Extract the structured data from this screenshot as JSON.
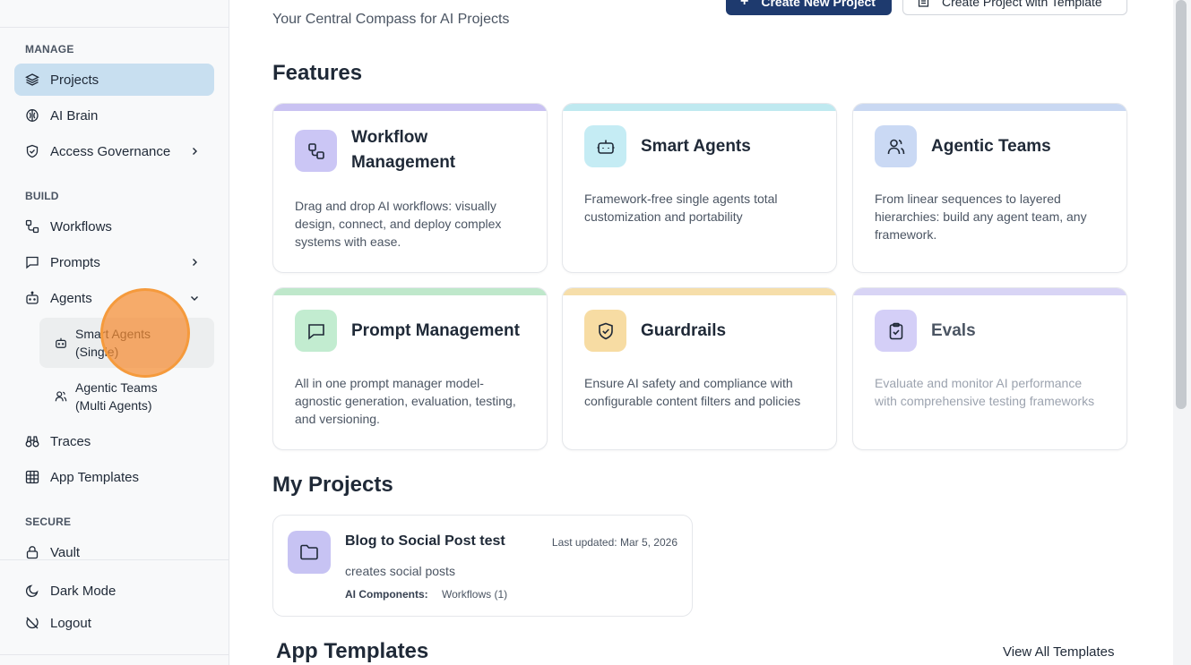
{
  "sidebar": {
    "sections": {
      "manage": "MANAGE",
      "build": "BUILD",
      "secure": "SECURE"
    },
    "items": {
      "projects": "Projects",
      "ai_brain": "AI Brain",
      "access_governance": "Access Governance",
      "workflows": "Workflows",
      "prompts": "Prompts",
      "agents": "Agents",
      "smart_agents_1": "Smart Agents",
      "smart_agents_2": "(Single)",
      "agentic_teams_1": "Agentic Teams",
      "agentic_teams_2": "(Multi Agents)",
      "traces": "Traces",
      "app_templates": "App Templates",
      "vault": "Vault",
      "dark_mode": "Dark Mode",
      "logout": "Logout"
    },
    "active_item": "projects"
  },
  "header": {
    "subtitle": "Your Central Compass for AI Projects",
    "create_new_project": "Create New Project",
    "create_with_template": "Create Project with Template"
  },
  "features": {
    "heading": "Features",
    "cards": [
      {
        "title1": "Workflow",
        "title2": "Management",
        "desc": "Drag and drop AI workflows: visually design, connect, and deploy complex systems with ease.",
        "bar_color": "#c9c2f2",
        "icon_bg": "#cbc6f5",
        "icon": "workflow-icon"
      },
      {
        "title1": "Smart Agents",
        "desc": "Framework-free single agents total customization and portability",
        "bar_color": "#bfe9f0",
        "icon_bg": "#c5ecf4",
        "icon": "bot-icon"
      },
      {
        "title1": "Agentic Teams",
        "desc": "From linear sequences to layered hierarchies: build any agent team, any framework.",
        "bar_color": "#c9d8f2",
        "icon_bg": "#cad9f4",
        "icon": "users-icon"
      },
      {
        "title1": "Prompt Management",
        "desc": "All in one prompt manager model-agnostic generation, evaluation, testing, and versioning.",
        "bar_color": "#bfe8cb",
        "icon_bg": "#c2ecd0",
        "icon": "message-icon"
      },
      {
        "title1": "Guardrails",
        "desc": "Ensure AI safety and compliance with configurable content filters and policies",
        "bar_color": "#f6deaa",
        "icon_bg": "#f7dca3",
        "icon": "shield-check-icon"
      },
      {
        "title1": "Evals",
        "desc": "Evaluate and monitor AI performance with comprehensive testing frameworks",
        "bar_color": "#d8d4f5",
        "icon_bg": "#d4cff7",
        "icon": "clipboard-check-icon"
      }
    ]
  },
  "my_projects": {
    "heading": "My Projects",
    "projects": [
      {
        "name": "Blog to Social Post test",
        "updated": "Last updated: Mar 5, 2026",
        "description": "creates social posts",
        "components_label": "AI Components:",
        "components_value": "Workflows (1)"
      }
    ]
  },
  "app_templates": {
    "heading": "App Templates",
    "view_all": "View All Templates"
  }
}
